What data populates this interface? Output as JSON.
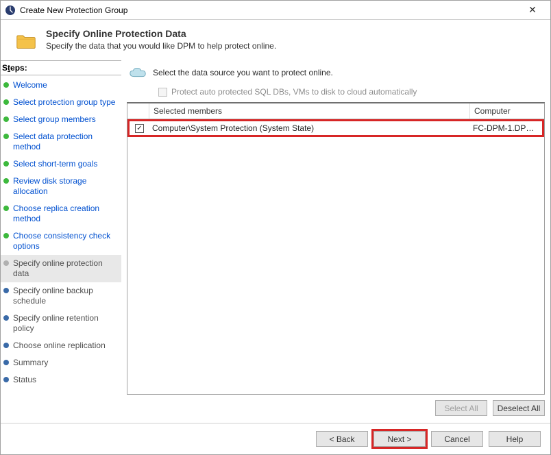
{
  "titlebar": {
    "title": "Create New Protection Group"
  },
  "header": {
    "title": "Specify Online Protection Data",
    "subtitle": "Specify the data that you would like DPM to help protect online."
  },
  "steps": {
    "label_prefix": "S",
    "label_ul": "t",
    "label_suffix": "eps:",
    "items": [
      {
        "label": "Welcome",
        "state": "done"
      },
      {
        "label": "Select protection group type",
        "state": "done"
      },
      {
        "label": "Select group members",
        "state": "done"
      },
      {
        "label": "Select data protection method",
        "state": "done"
      },
      {
        "label": "Select short-term goals",
        "state": "done"
      },
      {
        "label": "Review disk storage allocation",
        "state": "done"
      },
      {
        "label": "Choose replica creation method",
        "state": "done"
      },
      {
        "label": "Choose consistency check options",
        "state": "done"
      },
      {
        "label": "Specify online protection data",
        "state": "current"
      },
      {
        "label": "Specify online backup schedule",
        "state": "future"
      },
      {
        "label": "Specify online retention policy",
        "state": "future"
      },
      {
        "label": "Choose online replication",
        "state": "future"
      },
      {
        "label": "Summary",
        "state": "future"
      },
      {
        "label": "Status",
        "state": "future"
      }
    ]
  },
  "main": {
    "instruction": "Select the data source you want to protect online.",
    "auto_protect_label": "Protect auto protected SQL DBs, VMs to disk to cloud automatically",
    "grid": {
      "header_members": "Selected members",
      "header_computer": "Computer",
      "rows": [
        {
          "checked": true,
          "member": "Computer\\System Protection (System State)",
          "computer": "FC-DPM-1.DPM..."
        }
      ]
    },
    "select_all_label": "Select All",
    "deselect_all_label": "Deselect All"
  },
  "footer": {
    "back": "< Back",
    "next": "Next >",
    "cancel": "Cancel",
    "help": "Help"
  }
}
